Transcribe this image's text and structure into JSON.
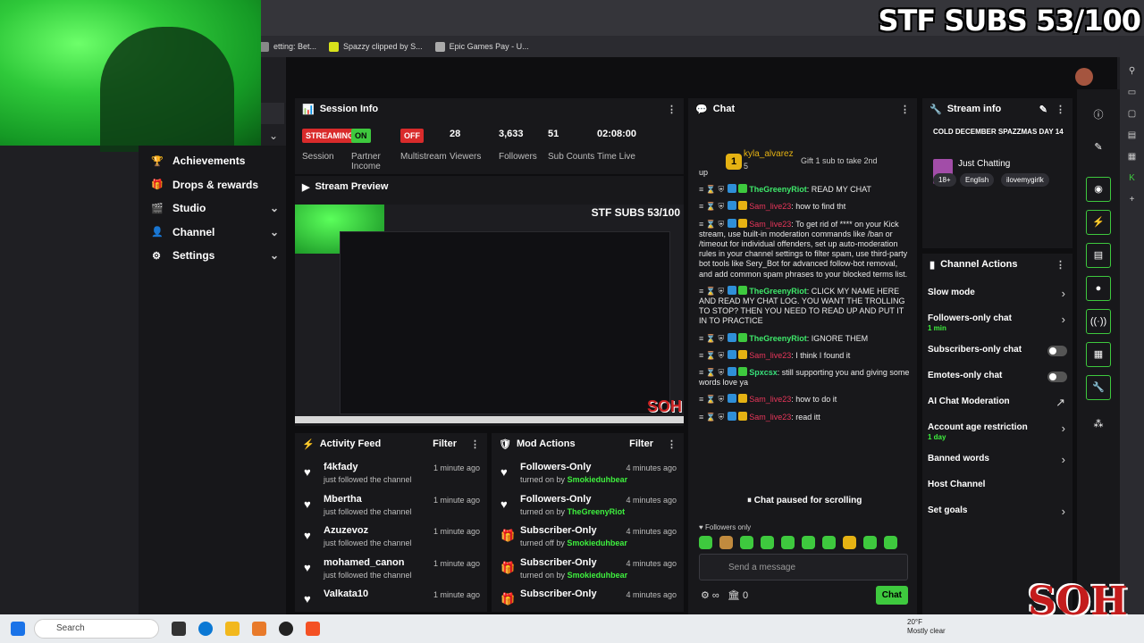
{
  "overlay": {
    "title": "STF SUBS 53/100",
    "logo_text": "SOH"
  },
  "bookmarks": [
    {
      "label": "etting: Bet...",
      "color": "#888888"
    },
    {
      "label": "Spazzy clipped by S...",
      "color": "#d8e21b"
    },
    {
      "label": "Epic Games Pay - U...",
      "color": "#aaaaaa"
    }
  ],
  "nav": {
    "items": [
      {
        "label": "Achievements",
        "icon": "trophy-icon",
        "glyph": "🏆",
        "chevron": false
      },
      {
        "label": "Drops & rewards",
        "icon": "gift-icon",
        "glyph": "🎁",
        "chevron": false
      },
      {
        "label": "Studio",
        "icon": "studio-icon",
        "glyph": "🎬",
        "chevron": true
      },
      {
        "label": "Channel",
        "icon": "channel-icon",
        "glyph": "👤",
        "chevron": true
      },
      {
        "label": "Settings",
        "icon": "gear-icon",
        "glyph": "⚙",
        "chevron": true
      }
    ]
  },
  "session": {
    "title": "Session Info",
    "cells": [
      {
        "value": "STREAMING",
        "label": "Session",
        "kind": "red"
      },
      {
        "value": "ON",
        "label": "Partner Income",
        "kind": "green"
      },
      {
        "value": "OFF",
        "label": "Multistream",
        "kind": "red"
      },
      {
        "value": "28",
        "label": "Viewers",
        "kind": "num"
      },
      {
        "value": "3,633",
        "label": "Followers",
        "kind": "num"
      },
      {
        "value": "51",
        "label": "Sub Counts",
        "kind": "num"
      },
      {
        "value": "02:08:00",
        "label": "Time Live",
        "kind": "num"
      }
    ]
  },
  "preview": {
    "title": "Stream Preview",
    "overlay_title": "STF SUBS 53/100",
    "logo": "SOH"
  },
  "activity": {
    "title": "Activity Feed",
    "filter": "Filter",
    "items": [
      {
        "name": "f4kfady",
        "sub": "just followed the channel",
        "time": "1 minute ago"
      },
      {
        "name": "Mbertha",
        "sub": "just followed the channel",
        "time": "1 minute ago"
      },
      {
        "name": "Azuzevoz",
        "sub": "just followed the channel",
        "time": "1 minute ago"
      },
      {
        "name": "mohamed_canon",
        "sub": "just followed the channel",
        "time": "1 minute ago"
      },
      {
        "name": "Valkata10",
        "sub": "",
        "time": "1 minute ago"
      }
    ]
  },
  "mod": {
    "title": "Mod Actions",
    "filter": "Filter",
    "items": [
      {
        "name": "Followers-Only",
        "pre": "turned on by",
        "by": "Smokieduhbear",
        "time": "4 minutes ago",
        "icon": "heart-icon",
        "glyph": "♥"
      },
      {
        "name": "Followers-Only",
        "pre": "turned on by",
        "by": "TheGreenyRiot",
        "time": "4 minutes ago",
        "icon": "heart-icon",
        "glyph": "♥"
      },
      {
        "name": "Subscriber-Only",
        "pre": "turned off by",
        "by": "Smokieduhbear",
        "time": "4 minutes ago",
        "icon": "gift-icon",
        "glyph": "🎁"
      },
      {
        "name": "Subscriber-Only",
        "pre": "turned on by",
        "by": "Smokieduhbear",
        "time": "4 minutes ago",
        "icon": "gift-icon",
        "glyph": "🎁"
      },
      {
        "name": "Subscriber-Only",
        "pre": "",
        "by": "",
        "time": "4 minutes ago",
        "icon": "gift-icon",
        "glyph": "🎁"
      }
    ]
  },
  "chat": {
    "title": "Chat",
    "top_rank": "1",
    "top_user": "kyla_alvarez",
    "top_count": "5",
    "gift_text": "Gift 1 sub to take 2nd",
    "messages": [
      {
        "user": "",
        "text": "up",
        "color": "plain"
      },
      {
        "user": "TheGreenyRiot",
        "text": ": READ MY CHAT",
        "color": "green"
      },
      {
        "user": "Sam_live23",
        "text": ": how to find tht",
        "color": "red"
      },
      {
        "user": "Sam_live23",
        "text": ": To get rid of **** on your Kick stream, use built-in moderation commands like /ban or /timeout for individual offenders, set up auto-moderation rules in your channel settings to filter spam, use third-party bot tools like Sery_Bot for advanced follow-bot removal, and add common spam phrases to your blocked terms list.",
        "color": "red"
      },
      {
        "user": "TheGreenyRiot",
        "text": ": CLICK MY NAME HERE AND READ MY CHAT LOG. YOU WANT THE TROLLING TO STOP? THEN YOU NEED TO READ UP AND PUT IT IN TO PRACTICE",
        "color": "green"
      },
      {
        "user": "TheGreenyRiot",
        "text": ": IGNORE THEM",
        "color": "green"
      },
      {
        "user": "Sam_live23",
        "text": ": I think I found it",
        "color": "red"
      },
      {
        "user": "Spxcsx",
        "text": ": still supporting you and giving some words love ya",
        "color": "teal"
      },
      {
        "user": "Sam_live23",
        "text": ": how to do it",
        "color": "red"
      },
      {
        "user": "Sam_live23",
        "text": ": read itt",
        "color": "red"
      }
    ],
    "paused": "Chat paused for scrolling",
    "followers_only": "Followers only",
    "placeholder": "Send a message",
    "count": "0",
    "send_label": "Chat"
  },
  "stream_info": {
    "title": "Stream info",
    "stream_title": "COLD DECEMBER SPAZZMAS DAY 14",
    "category": "Just Chatting",
    "tags": [
      "18+",
      "English",
      "ilovemygirlk"
    ]
  },
  "channel_actions": {
    "title": "Channel Actions",
    "items": [
      {
        "label": "Slow mode",
        "sub": "",
        "control": "chevron"
      },
      {
        "label": "Followers-only chat",
        "sub": "1 min",
        "control": "chevron"
      },
      {
        "label": "Subscribers-only chat",
        "sub": "",
        "control": "toggle"
      },
      {
        "label": "Emotes-only chat",
        "sub": "",
        "control": "toggle"
      },
      {
        "label": "AI Chat Moderation",
        "sub": "",
        "control": "external"
      },
      {
        "label": "Account age restriction",
        "sub": "1 day",
        "control": "chevron"
      },
      {
        "label": "Banned words",
        "sub": "",
        "control": "chevron"
      },
      {
        "label": "Host Channel",
        "sub": "",
        "control": "none"
      },
      {
        "label": "Set goals",
        "sub": "",
        "control": "chevron"
      }
    ]
  },
  "taskbar": {
    "search": "Search",
    "temp": "20°F",
    "weather": "Mostly clear"
  },
  "colors": {
    "accent": "#3ec93e",
    "danger": "#d92b2b",
    "panel": "#18181b"
  }
}
